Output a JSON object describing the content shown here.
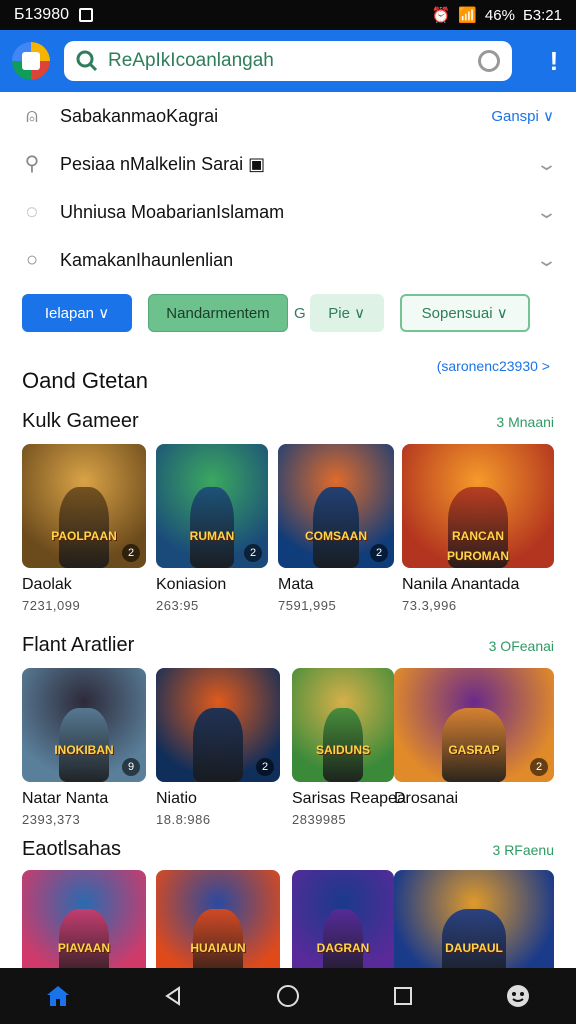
{
  "status_bar": {
    "left_text": "Б13980",
    "battery": "46%",
    "time": "Б3:21"
  },
  "search": {
    "value": "",
    "placeholder": "ReApIkIcoanlangah"
  },
  "suggestions": [
    {
      "icon": "history-icon",
      "label": "SabakanmaoKagrai",
      "right": "Ganspi ∨"
    },
    {
      "icon": "search-icon",
      "label": "Pesiaa nMalkelin Sarai ▣",
      "right": "⌄"
    },
    {
      "icon": "chat-icon",
      "label": "Uhniusa MoabarianIslamam",
      "right": "⌄"
    },
    {
      "icon": "circle-icon",
      "label": "KamakanIhaunlenlian",
      "right": "⌄"
    }
  ],
  "filters": {
    "chip1": "Ielapan ∨",
    "chip2": "Nandarmentem",
    "chip3_prefix": "G",
    "chip3": "Pie ∨",
    "chip4": "Sopensuai ∨"
  },
  "page": {
    "title": "Oand Gtetan",
    "more": "(saronenc23930 >"
  },
  "sections": [
    {
      "title": "Kulk Gameer",
      "more": "3 Mnaani",
      "cards": [
        {
          "banner": "PAOLPAAN",
          "badge": "2",
          "name": "Daolak",
          "meta": "7231,099",
          "c1": "#6b4a1c",
          "c2": "#d9a347"
        },
        {
          "banner": "RUMAN",
          "badge": "2",
          "name": "Koniasion",
          "meta": "263:95",
          "c1": "#1a4a7a",
          "c2": "#3ba860"
        },
        {
          "banner": "COMSAAN",
          "badge": "2",
          "name": "Mata",
          "meta": "7591,995",
          "c1": "#0f3c7a",
          "c2": "#e06b2b"
        },
        {
          "banner": "RANCAN PUROMAN",
          "badge": "",
          "name": "Nanila Anantada",
          "meta": "73.3,996",
          "c1": "#b3351f",
          "c2": "#f59a2a"
        }
      ]
    },
    {
      "title": "Flant Aratlier",
      "more": "3 OFeanai",
      "cards": [
        {
          "banner": "INOKIBAN",
          "badge": "9",
          "name": "Natar Nanta",
          "meta": "2393,373",
          "c1": "#5a7f9a",
          "c2": "#2d2a3a"
        },
        {
          "banner": "",
          "badge": "2",
          "name": "Niatio",
          "meta": "18.8:986",
          "c1": "#0f2e5a",
          "c2": "#e05a1c"
        },
        {
          "banner": "SAIDUNS",
          "badge": "",
          "name": "Sarisas Reapea",
          "meta": "2839985",
          "c1": "#3a8a3a",
          "c2": "#d6b04a"
        },
        {
          "banner": "GASRAP",
          "badge": "2",
          "name": "Drosanai",
          "meta": "",
          "c1": "#e08a2a",
          "c2": "#6a2a8a"
        }
      ]
    },
    {
      "title": "Eaotlsahas",
      "more": "3 RFaenu",
      "cards": [
        {
          "banner": "PIAVAAN",
          "badge": "",
          "name": "",
          "meta": "",
          "c1": "#d03a6a",
          "c2": "#2a6ab0"
        },
        {
          "banner": "HUAIAUN",
          "badge": "",
          "name": "",
          "meta": "",
          "c1": "#e04a1a",
          "c2": "#2a4aa0"
        },
        {
          "banner": "DAGRAN",
          "badge": "",
          "name": "",
          "meta": "",
          "c1": "#5a2a9a",
          "c2": "#1a3a8a"
        },
        {
          "banner": "DAUPAUL",
          "badge": "",
          "name": "",
          "meta": "",
          "c1": "#1a3a8a",
          "c2": "#e09a2a"
        }
      ]
    }
  ],
  "colors": {
    "appbar": "#1a73e8",
    "accent_green": "#2e9b62"
  }
}
